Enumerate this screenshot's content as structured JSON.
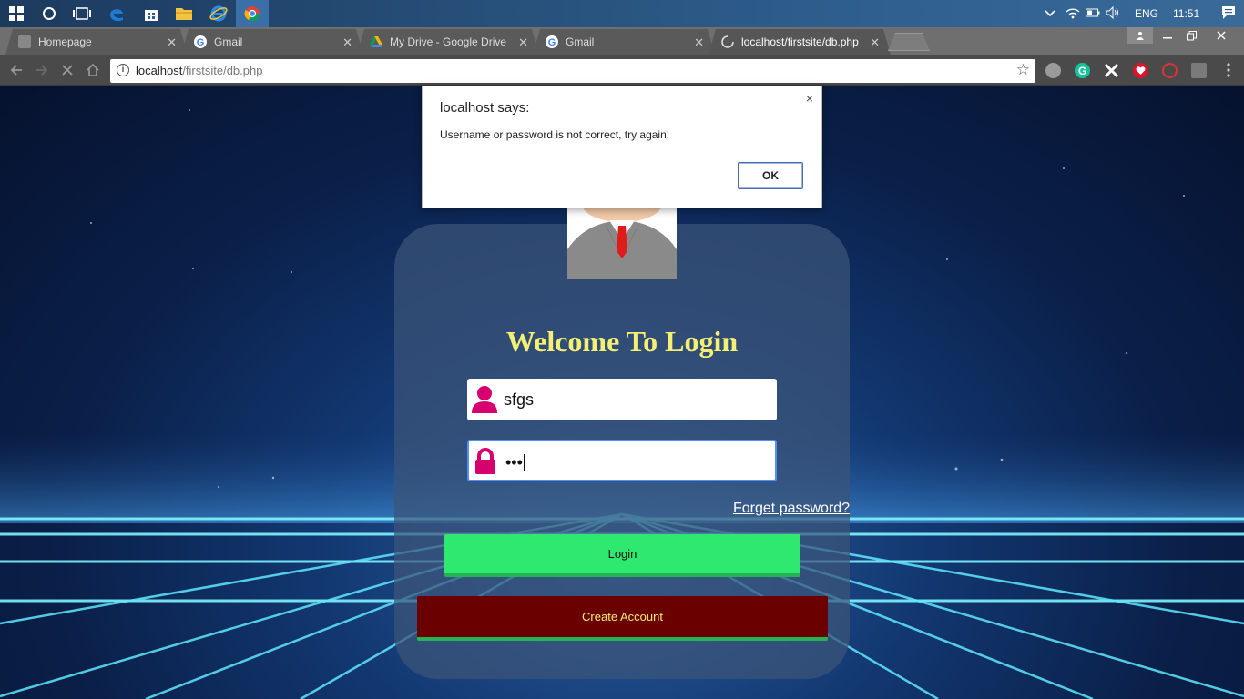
{
  "taskbar": {
    "clock": "11:51",
    "language": "ENG"
  },
  "tabs": [
    {
      "title": "Homepage",
      "favicon": "page-icon",
      "active": false
    },
    {
      "title": "Gmail",
      "favicon": "google-icon",
      "active": false
    },
    {
      "title": "My Drive - Google Drive",
      "favicon": "drive-icon",
      "active": false
    },
    {
      "title": "Gmail",
      "favicon": "google-icon",
      "active": false
    },
    {
      "title": "localhost/firstsite/db.php",
      "favicon": "loading-icon",
      "active": true
    }
  ],
  "address_bar": {
    "host": "localhost",
    "path": "/firstsite/db.php"
  },
  "dialog": {
    "title": "localhost says:",
    "message": "Username or password is not correct, try again!",
    "ok_label": "OK",
    "close_label": "×"
  },
  "login": {
    "heading": "Welcome To Login",
    "username_value": "sfgs",
    "password_value": "•••",
    "forgot_label": "Forget password?",
    "login_label": "Login",
    "create_label": "Create Account"
  },
  "colors": {
    "heading": "#f5f074",
    "login_button": "#2ee870",
    "create_button": "#6b0000",
    "field_icon": "#d6006f"
  }
}
